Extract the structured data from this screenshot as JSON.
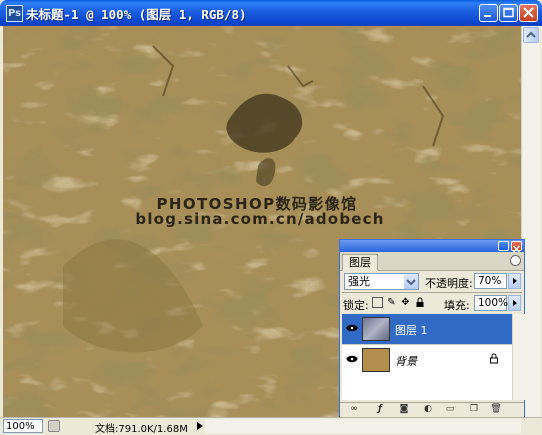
{
  "window": {
    "title": "未标题-1 @ 100% (图层 1, RGB/8)",
    "controls": [
      "minimize-icon",
      "maximize-icon",
      "close-icon"
    ]
  },
  "canvas": {
    "watermark_line1": "PHOTOSHOP数码影像馆",
    "watermark_line2": "blog.sina.com.cn/adobech",
    "colors": {
      "base": "#a98f57",
      "dark": "#5e4d1e",
      "light": "#c7b07c"
    }
  },
  "status": {
    "zoom": "100%",
    "doc_info": "文档:791.0K/1.68M"
  },
  "layers_panel": {
    "tab": "图层",
    "blend_mode": "强光",
    "opacity_label": "不透明度:",
    "opacity_value": "70%",
    "lock_label": "锁定:",
    "fill_label": "填充:",
    "fill_value": "100%",
    "layers": [
      {
        "name": "图层 1",
        "selected": true,
        "visible": true
      },
      {
        "name": "背景",
        "selected": false,
        "visible": true,
        "locked": true
      }
    ],
    "bottom_icons": [
      "link-icon",
      "style-icon",
      "mask-icon",
      "adjustment-icon",
      "folder-icon",
      "new-layer-icon",
      "trash-icon"
    ],
    "accent": "#316ac5"
  }
}
